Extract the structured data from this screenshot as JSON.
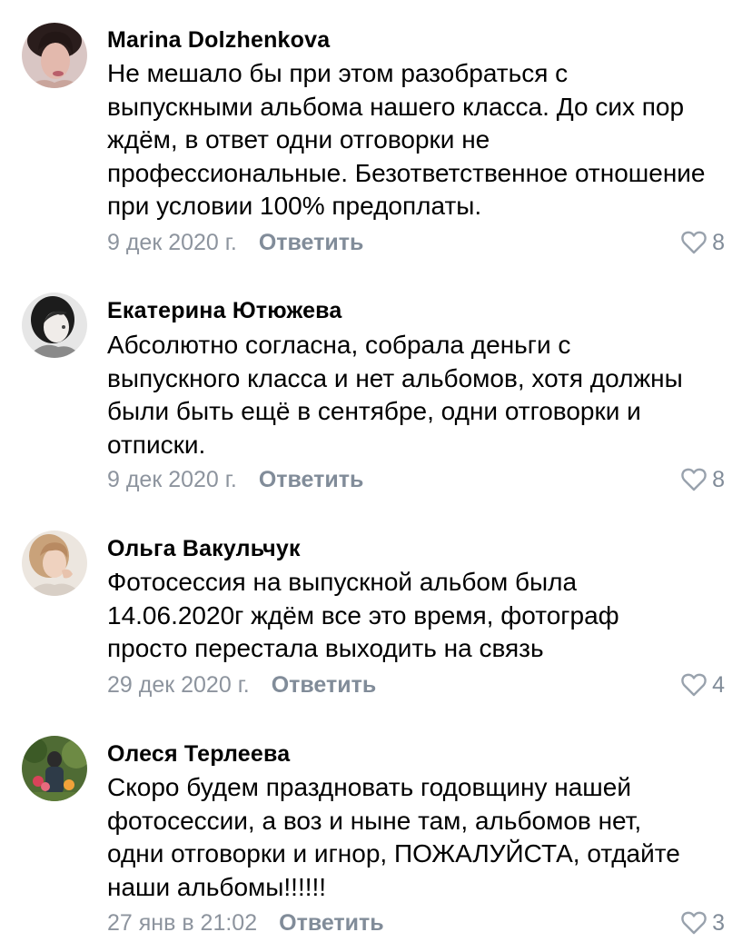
{
  "reply_label": "Ответить",
  "comments": [
    {
      "author": "Marina Dolzhenkova",
      "text": "Не мешало бы при этом разобраться с\nвыпускными альбома нашего класса. До сих пор\nждём, в ответ одни отговорки не\nпрофессиональные. Безответственное отношение\nпри условии 100% предоплаты.",
      "date": "9 дек 2020 г.",
      "likes": "8"
    },
    {
      "author": "Екатерина Ютюжева",
      "text": "Абсолютно согласна, собрала деньги с\nвыпускного класса и нет альбомов, хотя должны\nбыли быть ещё в сентябре, одни отговорки и\nотписки.",
      "date": "9 дек 2020 г.",
      "likes": "8"
    },
    {
      "author": "Ольга Вакульчук",
      "text": "Фотосессия на выпускной альбом была\n14.06.2020г ждём все это время, фотограф\nпросто перестала выходить на связь",
      "date": "29 дек 2020 г.",
      "likes": "4"
    },
    {
      "author": "Олеся Терлеева",
      "text": "Скоро будем праздновать годовщину нашей\nфотосессии, а воз и ныне там, альбомов нет,\nодни отговорки и игнор, ПОЖАЛУЙСТА, отдайте\nнаши альбомы!!!!!!",
      "date": "27 янв в 21:02",
      "likes": "3"
    }
  ]
}
